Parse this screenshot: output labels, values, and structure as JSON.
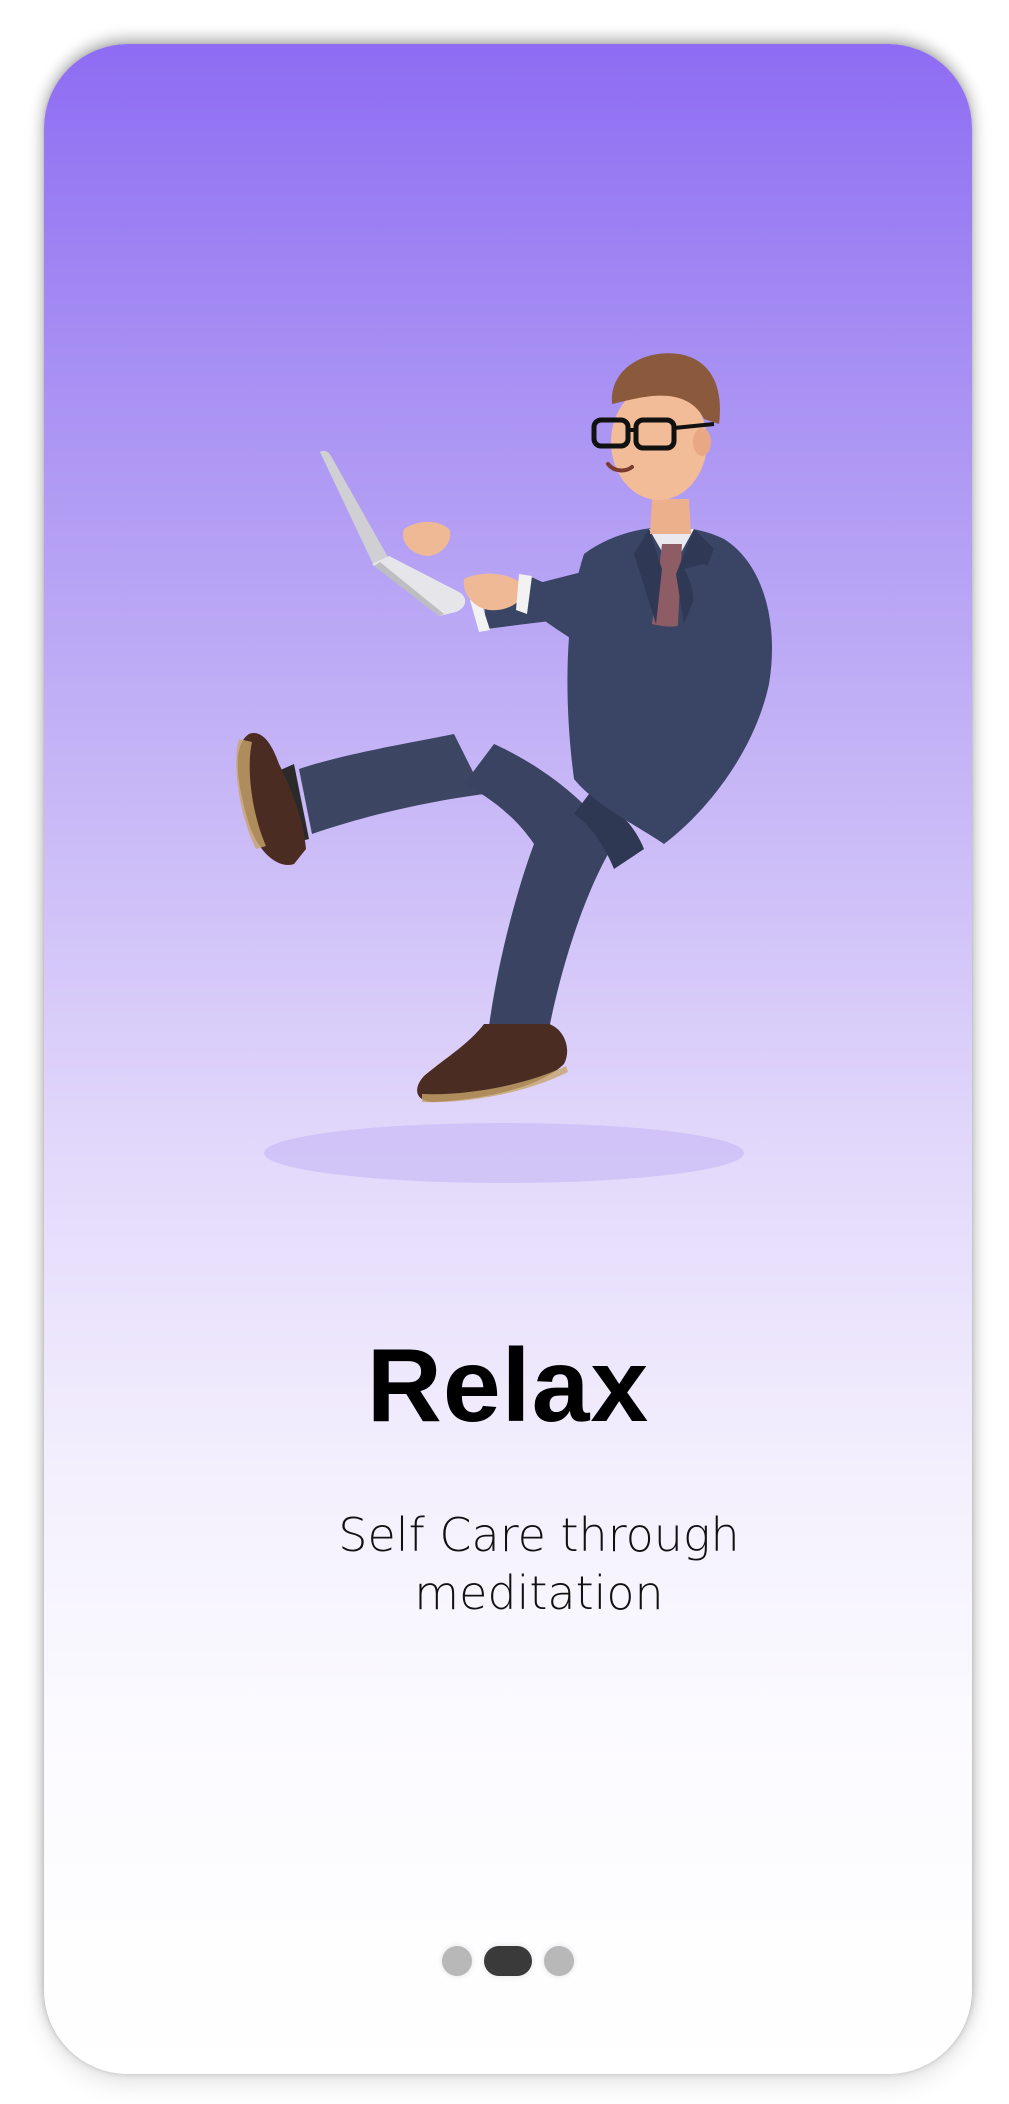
{
  "onboarding": {
    "title": "Relax",
    "subtitle": "Self Care through meditation",
    "illustration": "man-floating-with-laptop-illustration",
    "pagination": {
      "total_pages": 3,
      "current_page": 2
    }
  },
  "colors": {
    "gradient_top": "#8e6cf3",
    "gradient_bottom": "#ffffff",
    "title": "#000000",
    "dot_active": "#3a3a3a",
    "dot_inactive": "#b8b8b8"
  }
}
